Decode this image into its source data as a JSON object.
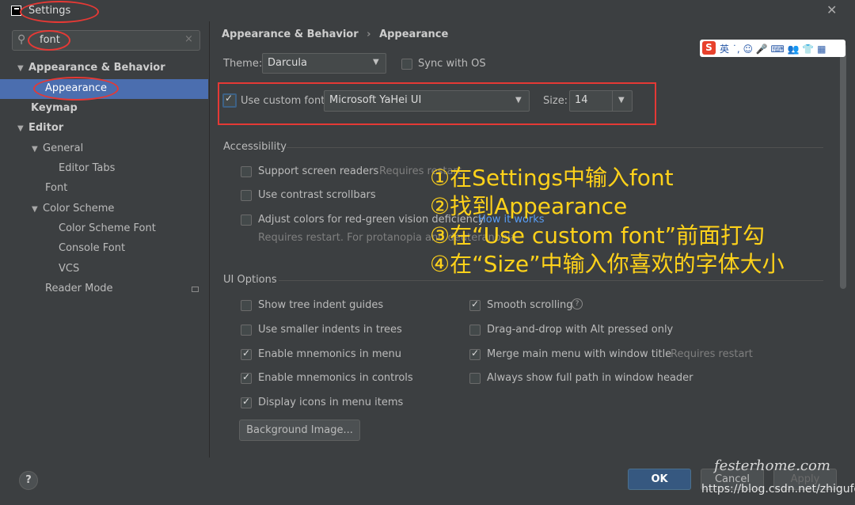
{
  "window": {
    "title": "Settings",
    "close_glyph": "✕"
  },
  "search": {
    "value": "font",
    "clear_glyph": "×"
  },
  "sidebar": {
    "items": [
      {
        "label": "Appearance & Behavior"
      },
      {
        "label": "Appearance"
      },
      {
        "label": "Keymap"
      },
      {
        "label": "Editor"
      },
      {
        "label": "General"
      },
      {
        "label": "Editor Tabs"
      },
      {
        "label": "Font"
      },
      {
        "label": "Color Scheme"
      },
      {
        "label": "Color Scheme Font"
      },
      {
        "label": "Console Font"
      },
      {
        "label": "VCS"
      },
      {
        "label": "Reader Mode"
      }
    ]
  },
  "breadcrumb": {
    "parent": "Appearance & Behavior",
    "sep": "›",
    "current": "Appearance"
  },
  "theme": {
    "label": "Theme:",
    "value": "Darcula",
    "sync_label": "Sync with OS",
    "sync_checked": false
  },
  "font": {
    "checkbox_label": "Use custom font:",
    "checked": true,
    "value": "Microsoft YaHei UI",
    "size_label": "Size:",
    "size_value": "14"
  },
  "accessibility": {
    "title": "Accessibility",
    "screen_readers": "Support screen readers",
    "screen_readers_hint": "Requires restart",
    "contrast_scrollbars": "Use contrast scrollbars",
    "adjust_colors": "Adjust colors for red-green vision deficiency",
    "adjust_link": "How it works",
    "adjust_hint": "Requires restart. For protanopia and deuteranopia"
  },
  "ui_options": {
    "title": "UI Options",
    "left": [
      {
        "label": "Show tree indent guides",
        "checked": false
      },
      {
        "label": "Use smaller indents in trees",
        "checked": false
      },
      {
        "label": "Enable mnemonics in menu",
        "checked": true
      },
      {
        "label": "Enable mnemonics in controls",
        "checked": true
      },
      {
        "label": "Display icons in menu items",
        "checked": true
      }
    ],
    "right": [
      {
        "label": "Smooth scrolling",
        "checked": true
      },
      {
        "label": "Drag-and-drop with Alt pressed only",
        "checked": false
      },
      {
        "label": "Merge main menu with window title",
        "checked": true
      },
      {
        "label": "Always show full path in window header",
        "checked": false
      }
    ],
    "merge_hint": "Requires restart",
    "background_button": "Background Image..."
  },
  "footer": {
    "help": "?",
    "ok": "OK",
    "cancel": "Cancel",
    "apply": "Apply"
  },
  "annotations": [
    "①在Settings中输入font",
    "②找到Appearance",
    "③在“Use custom font”前面打勾",
    "④在“Size”中输入你喜欢的字体大小"
  ],
  "ime_toolbar": {
    "logo": "S",
    "text": "英 ˙, ☺ 🎤 ⌨ 👥 👕 ▦"
  },
  "watermark": {
    "handwritten": "festerhome.com",
    "url": "https://blog.csdn.net/zhigufgu"
  },
  "colors": {
    "accent": "#4b6eaf",
    "highlight_red": "#e53935",
    "annotation_yellow": "#ffd21a",
    "ok_blue": "#365880"
  }
}
